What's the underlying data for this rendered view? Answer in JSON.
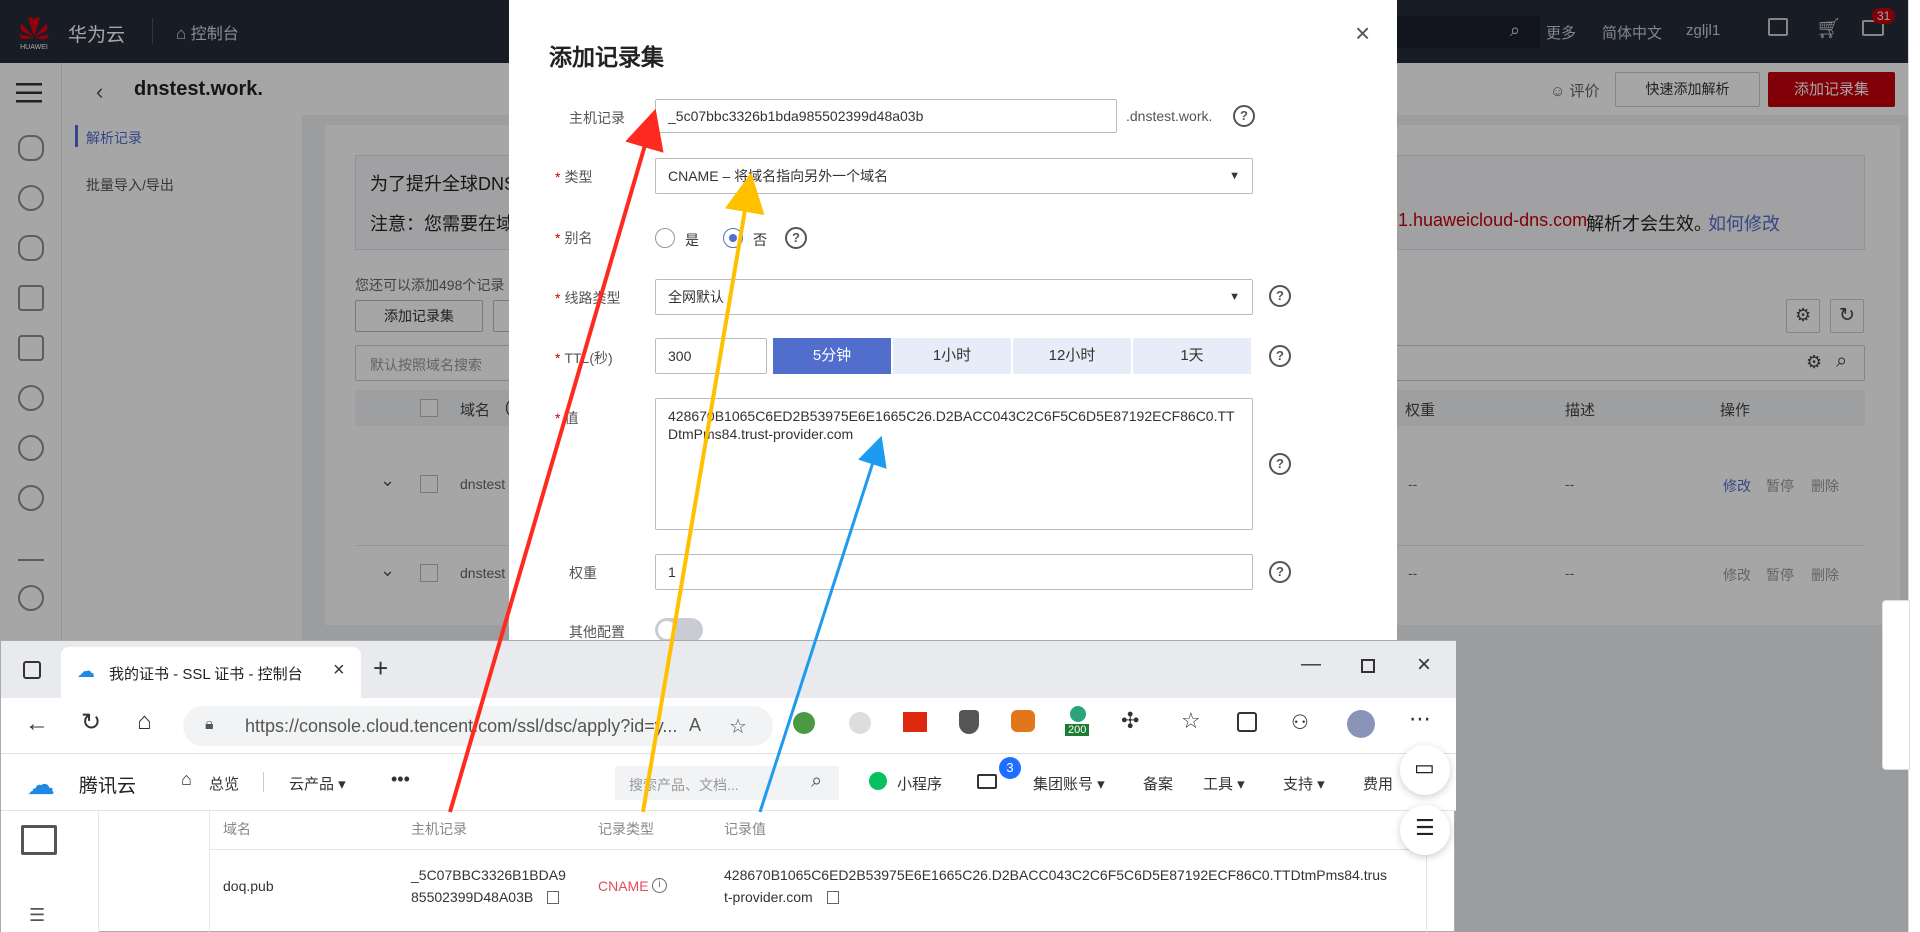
{
  "topbar": {
    "logo_text": "HUAWEI",
    "brand": "华为云",
    "console": "控制台",
    "more": "更多",
    "lang": "简体中文",
    "user": "zgljl1",
    "badge": "31"
  },
  "subnav": {
    "items": [
      "解析记录",
      "批量导入/导出"
    ]
  },
  "header": {
    "domain": "dnstest.work.",
    "rate": "评价",
    "quick_add": "快速添加解析",
    "add_record": "添加记录集"
  },
  "notice": {
    "line1": "为了提升全球DNS",
    "line2": "注意：您需要在域",
    "red": "1.huaweicloud-dns.com",
    "tail": "解析才会生效。",
    "link": "如何修改"
  },
  "list": {
    "can_add": "您还可以添加498个记录",
    "add_btn": "添加记录集",
    "search_placeholder": "默认按照域名搜索",
    "headers": [
      "域名",
      "(",
      "权重",
      "描述",
      "操作"
    ],
    "rows": [
      {
        "domain": "dnstest",
        "weight": "--",
        "desc": "--",
        "ops": [
          "修改",
          "暂停",
          "删除"
        ]
      },
      {
        "domain": "dnstest",
        "weight": "--",
        "desc": "--",
        "ops": [
          "修改",
          "暂停",
          "删除"
        ]
      }
    ]
  },
  "modal": {
    "title": "添加记录集",
    "host_label": "主机记录",
    "host_value": "_5c07bbc3326b1bda985502399d48a03b",
    "host_suffix": ".dnstest.work.",
    "type_label": "类型",
    "type_value": "CNAME – 将域名指向另外一个域名",
    "alias_label": "别名",
    "alias_yes": "是",
    "alias_no": "否",
    "line_label": "线路类型",
    "line_value": "全网默认",
    "ttl_label": "TTL(秒)",
    "ttl_value": "300",
    "ttl_options": [
      "5分钟",
      "1小时",
      "12小时",
      "1天"
    ],
    "value_label": "值",
    "value_text": "428670B1065C6ED2B53975E6E1665C26.D2BACC043C2C6F5C6D5E87192ECF86C0.TTDtmPms84.trust-provider.com",
    "weight_label": "权重",
    "weight_value": "1",
    "other_label": "其他配置"
  },
  "edge": {
    "tab_title": "我的证书 - SSL 证书 - 控制台",
    "url": "https://console.cloud.tencent.com/ssl/dsc/apply?id=y...",
    "ext_badge": "200",
    "tencent": {
      "brand": "腾讯云",
      "overview": "总览",
      "products": "云产品",
      "search_placeholder": "搜索产品、文档...",
      "miniprogram": "小程序",
      "msg_badge": "3",
      "group": "集团账号",
      "beian": "备案",
      "tools": "工具",
      "support": "支持",
      "fees": "费用"
    },
    "table": {
      "headers": [
        "域名",
        "主机记录",
        "记录类型",
        "记录值"
      ],
      "domain": "doq.pub",
      "host_line1": "_5C07BBC3326B1BDA9",
      "host_line2": "85502399D48A03B",
      "type": "CNAME",
      "value_line1": "428670B1065C6ED2B53975E6E1665C26.D2BACC043C2C6F5C6D5E87192ECF86C0.TTDtmPms84.trus",
      "value_line2": "t-provider.com"
    }
  },
  "colors": {
    "huawei_red": "#c7000b",
    "accent_blue": "#526ecc",
    "arrow_red": "#ff2a1f",
    "arrow_yellow": "#ffc000",
    "arrow_blue": "#1e9bf0"
  }
}
